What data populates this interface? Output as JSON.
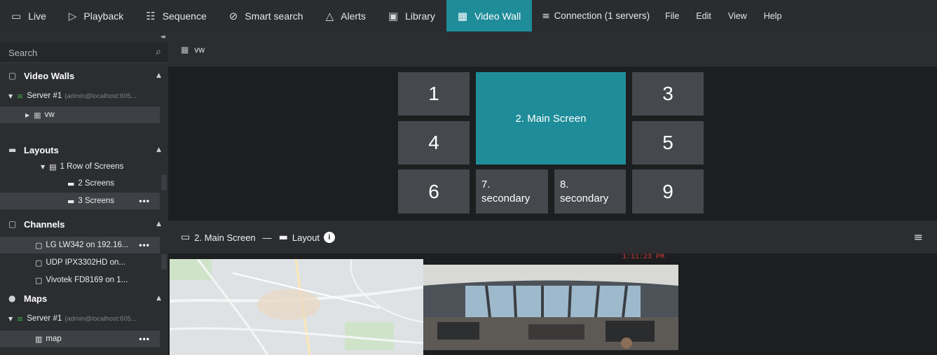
{
  "menubar": {
    "tabs": [
      {
        "label": "Live",
        "icon": "monitor-icon"
      },
      {
        "label": "Playback",
        "icon": "play-icon"
      },
      {
        "label": "Sequence",
        "icon": "sequence-icon"
      },
      {
        "label": "Smart search",
        "icon": "smart-search-icon"
      },
      {
        "label": "Alerts",
        "icon": "bell-icon"
      },
      {
        "label": "Library",
        "icon": "library-icon"
      },
      {
        "label": "Video Wall",
        "icon": "video-wall-icon",
        "active": true
      }
    ],
    "connection": "Connection (1 servers)",
    "menus": [
      "File",
      "Edit",
      "View",
      "Help"
    ],
    "accent_color": "#1e8c99"
  },
  "sidebar": {
    "search_placeholder": "Search",
    "video_walls": {
      "title": "Video Walls",
      "server_name": "Server #1",
      "server_detail": "(admin@localhost:605...",
      "wall_item": "vw"
    },
    "layouts": {
      "title": "Layouts",
      "group": "1 Row of Screens",
      "items": [
        "2 Screens",
        "3 Screens"
      ]
    },
    "channels": {
      "title": "Channels",
      "items": [
        "LG LW342 on 192.16...",
        "UDP IPX3302HD on...",
        "Vivotek FD8169 on 1..."
      ]
    },
    "maps": {
      "title": "Maps",
      "server_name": "Server #1",
      "server_detail": "(admin@localhost:605...",
      "item": "map"
    },
    "more_label": "•••"
  },
  "wall": {
    "name": "vw",
    "cells": {
      "c1": "1",
      "main": "2. Main Screen",
      "c3": "3",
      "c4": "4",
      "c5": "5",
      "c6": "6",
      "c7a": "7.",
      "c7b": "secondary",
      "c8a": "8.",
      "c8b": "secondary",
      "c9": "9"
    }
  },
  "screen": {
    "title": "2. Main Screen",
    "separator": "—",
    "layout_label": "Layout",
    "info_label": "i",
    "timestamp": "1:11:23 PM"
  }
}
